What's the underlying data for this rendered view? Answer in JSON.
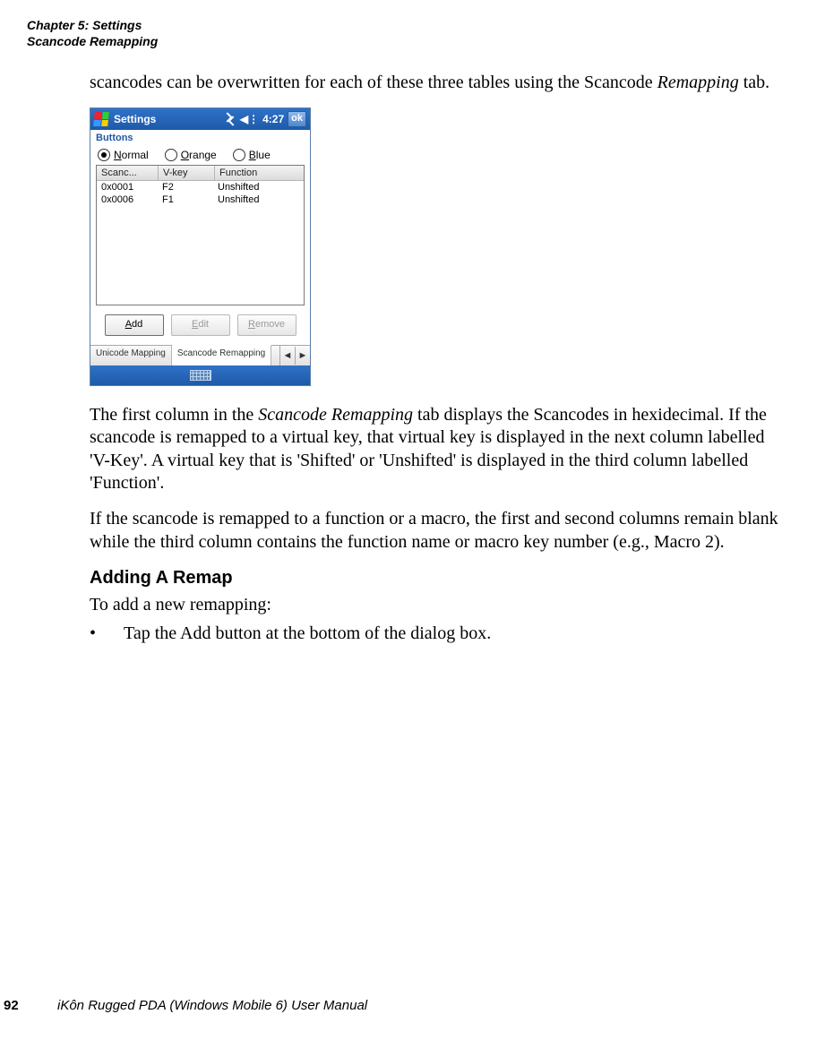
{
  "header": {
    "chapter": "Chapter 5:  Settings",
    "section": "Scancode Remapping"
  },
  "body": {
    "para1_a": "scancodes can be overwritten for each of these three tables using the Scancode ",
    "para1_b_italic": "Remapping",
    "para1_c": " tab.",
    "para2_a": "The first column in the ",
    "para2_b_italic": "Scancode Remapping",
    "para2_c": " tab displays the Scancodes in hexidecimal. If the scancode is remapped to a virtual key, that virtual key is displayed in the next column labelled 'V-Key'. A virtual key that is 'Shifted' or 'Unshifted' is displayed in the third column labelled 'Function'.",
    "para3": "If the scancode is remapped to a function or a macro, the first and second columns remain blank while the third column contains the function name or macro key number (e.g., Macro 2).",
    "subheading": "Adding A Remap",
    "para4": "To add a new remapping:",
    "bullet_a": "Tap the ",
    "bullet_b_bold": "Add",
    "bullet_c": " button at the bottom of the dialog box."
  },
  "pda": {
    "titlebar": {
      "title": "Settings",
      "time": "4:27",
      "ok": "ok"
    },
    "subheader": "Buttons",
    "radios": {
      "normal": {
        "u": "N",
        "rest": "ormal"
      },
      "orange": {
        "u": "O",
        "rest": "range"
      },
      "blue": {
        "u": "B",
        "rest": "lue"
      }
    },
    "table": {
      "headers": {
        "a": "Scanc...",
        "b": "V-key",
        "c": "Function"
      },
      "rows": [
        {
          "a": "0x0001",
          "b": "F2",
          "c": "Unshifted"
        },
        {
          "a": "0x0006",
          "b": "F1",
          "c": "Unshifted"
        }
      ]
    },
    "buttons": {
      "add": {
        "u": "A",
        "rest": "dd"
      },
      "edit": {
        "u": "E",
        "rest": "dit"
      },
      "remove": {
        "u": "R",
        "rest": "emove"
      }
    },
    "tabs": {
      "a": "Unicode Mapping",
      "b": "Scancode Remapping"
    }
  },
  "footer": {
    "page": "92",
    "book": "iKôn Rugged PDA (Windows Mobile 6) User Manual"
  }
}
